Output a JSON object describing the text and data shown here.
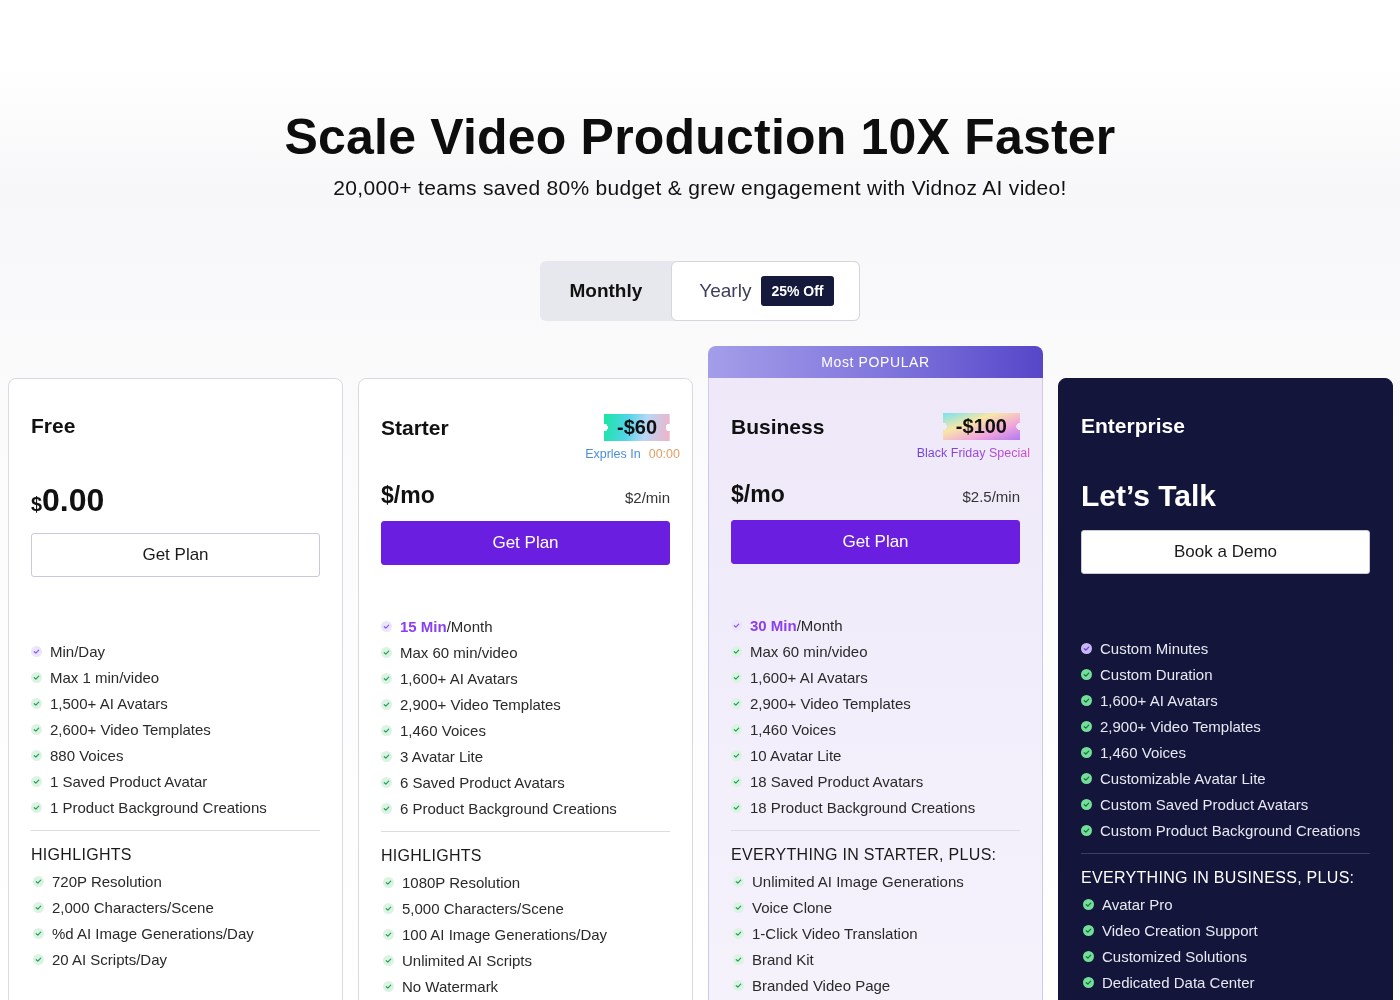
{
  "header": {
    "title": "Scale Video Production 10X Faster",
    "subtitle": "20,000+ teams saved 80% budget & grew engagement with Vidnoz AI video!"
  },
  "billing_toggle": [
    {
      "label": "Monthly",
      "selected": true
    },
    {
      "label": "Yearly",
      "selected": false,
      "badge": "25% Off"
    }
  ],
  "plans": [
    {
      "kind": "free",
      "name": "Free",
      "price": {
        "currency": "$",
        "amount": "0.00"
      },
      "button": {
        "label": "Get Plan",
        "primary": false
      },
      "features": [
        {
          "kind": "quota",
          "text": "Min/Day"
        },
        {
          "kind": "feature",
          "text": "Max 1 min/video"
        },
        {
          "kind": "feature",
          "text": "1,500+ AI Avatars"
        },
        {
          "kind": "feature",
          "text": "2,600+ Video Templates"
        },
        {
          "kind": "feature",
          "text": "880 Voices"
        },
        {
          "kind": "feature",
          "text": "1 Saved Product Avatar"
        },
        {
          "kind": "feature",
          "text": "1 Product Background Creations"
        }
      ],
      "section": {
        "heading": "HIGHLIGHTS",
        "items": [
          "720P Resolution",
          "2,000 Characters/Scene",
          "%d AI Image Generations/Day",
          "20 AI Scripts/Day"
        ]
      }
    },
    {
      "kind": "paid",
      "name": "Starter",
      "deal": {
        "kind": "countdown",
        "badge": "-$60",
        "note": "Exprles In",
        "timer": "00:00"
      },
      "price": {
        "amount": "$/mo",
        "rate": "$2/min"
      },
      "button": {
        "label": "Get Plan",
        "primary": true
      },
      "features": [
        {
          "kind": "quota",
          "amount": "15 Min",
          "text": "/Month"
        },
        {
          "kind": "feature",
          "text": "Max 60 min/video"
        },
        {
          "kind": "feature",
          "text": "1,600+ AI Avatars"
        },
        {
          "kind": "feature",
          "text": "2,900+ Video Templates"
        },
        {
          "kind": "feature",
          "text": "1,460 Voices"
        },
        {
          "kind": "feature",
          "text": "3 Avatar Lite"
        },
        {
          "kind": "feature",
          "text": "6 Saved Product Avatars"
        },
        {
          "kind": "feature",
          "text": "6 Product Background Creations"
        }
      ],
      "section": {
        "heading": "HIGHLIGHTS",
        "items": [
          "1080P Resolution",
          "5,000 Characters/Scene",
          "100 AI Image Generations/Day",
          "Unlimited AI Scripts",
          "No Watermark"
        ]
      }
    },
    {
      "kind": "paid",
      "ribbon": "Most POPULAR",
      "name": "Business",
      "deal": {
        "kind": "promo",
        "badge": "-$100",
        "note": "Black Friday Special"
      },
      "price": {
        "amount": "$/mo",
        "rate": "$2.5/min"
      },
      "button": {
        "label": "Get Plan",
        "primary": true
      },
      "features": [
        {
          "kind": "quota",
          "amount": "30 Min",
          "text": "/Month"
        },
        {
          "kind": "feature",
          "text": "Max 60 min/video"
        },
        {
          "kind": "feature",
          "text": "1,600+ AI Avatars"
        },
        {
          "kind": "feature",
          "text": "2,900+ Video Templates"
        },
        {
          "kind": "feature",
          "text": "1,460 Voices"
        },
        {
          "kind": "feature",
          "text": "10 Avatar Lite"
        },
        {
          "kind": "feature",
          "text": "18 Saved Product Avatars"
        },
        {
          "kind": "feature",
          "text": "18 Product Background Creations"
        }
      ],
      "section": {
        "heading": "EVERYTHING IN STARTER, PLUS:",
        "items": [
          "Unlimited AI Image Generations",
          "Voice Clone",
          "1-Click Video Translation",
          "Brand Kit",
          "Branded Video Page"
        ]
      }
    },
    {
      "kind": "enterprise",
      "name": "Enterprise",
      "price": {
        "amount": "Let’s Talk"
      },
      "button": {
        "label": "Book a Demo",
        "primary": false
      },
      "features": [
        {
          "kind": "quota",
          "text": "Custom Minutes"
        },
        {
          "kind": "feature",
          "text": "Custom Duration"
        },
        {
          "kind": "feature",
          "text": "1,600+ AI Avatars"
        },
        {
          "kind": "feature",
          "text": "2,900+ Video Templates"
        },
        {
          "kind": "feature",
          "text": "1,460 Voices"
        },
        {
          "kind": "feature",
          "text": "Customizable Avatar Lite"
        },
        {
          "kind": "feature",
          "text": "Custom Saved Product Avatars"
        },
        {
          "kind": "feature",
          "text": "Custom Product Background Creations"
        }
      ],
      "section": {
        "heading": "EVERYTHING IN BUSINESS, PLUS:",
        "items": [
          "Avatar Pro",
          "Video Creation Support",
          "Customized Solutions",
          "Dedicated Data Center"
        ]
      }
    }
  ]
}
